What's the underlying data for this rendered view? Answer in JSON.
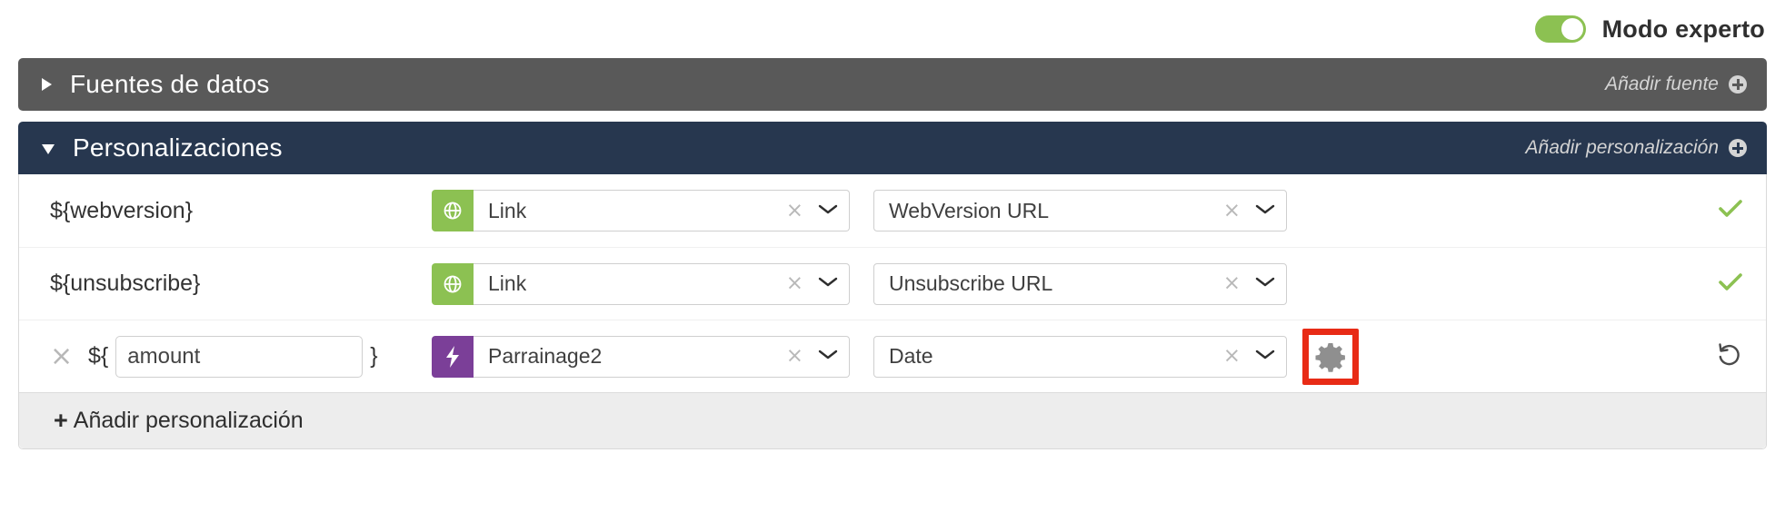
{
  "topbar": {
    "toggle_state": "on",
    "toggle_name": "expert-mode-toggle",
    "label": "Modo experto"
  },
  "panels": {
    "sources": {
      "title": "Fuentes de datos",
      "expanded": false,
      "caret": "caret-right-icon",
      "action_label": "Añadir fuente",
      "action_icon": "plus-circle-icon",
      "bg_color": "#595959"
    },
    "personalizations": {
      "title": "Personalizaciones",
      "expanded": true,
      "caret": "caret-down-icon",
      "action_label": "Añadir personalización",
      "action_icon": "plus-circle-icon",
      "bg_color": "#27374f"
    }
  },
  "rows": [
    {
      "variable": "${webversion}",
      "editable": false,
      "badge_icon": "globe-icon",
      "badge_color": "#8cc152",
      "type_value": "Link",
      "field_value": "WebVersion URL",
      "status": "valid",
      "status_icon": "check-icon",
      "status_color": "#8cc152"
    },
    {
      "variable": "${unsubscribe}",
      "editable": false,
      "badge_icon": "globe-icon",
      "badge_color": "#8cc152",
      "type_value": "Link",
      "field_value": "Unsubscribe URL",
      "status": "valid",
      "status_icon": "check-icon",
      "status_color": "#8cc152"
    },
    {
      "variable_prefix": "${",
      "variable_input_value": "amount",
      "variable_input_placeholder": "",
      "variable_suffix": "}",
      "editable": true,
      "delete_icon": "close-icon",
      "badge_icon": "lightning-bolt-icon",
      "badge_color": "#7b3f98",
      "type_value": "Parrainage2",
      "field_value": "Date",
      "gear_icon": "gear-icon",
      "gear_highlight_color": "#e82b16",
      "status": "reset",
      "status_icon": "reset-icon",
      "status_color": "#4a4a4a"
    }
  ],
  "controls": {
    "clear_icon": "clear-x-icon",
    "chevron_icon": "chevron-down-icon"
  },
  "footer": {
    "plus": "+",
    "label": "Añadir personalización"
  }
}
